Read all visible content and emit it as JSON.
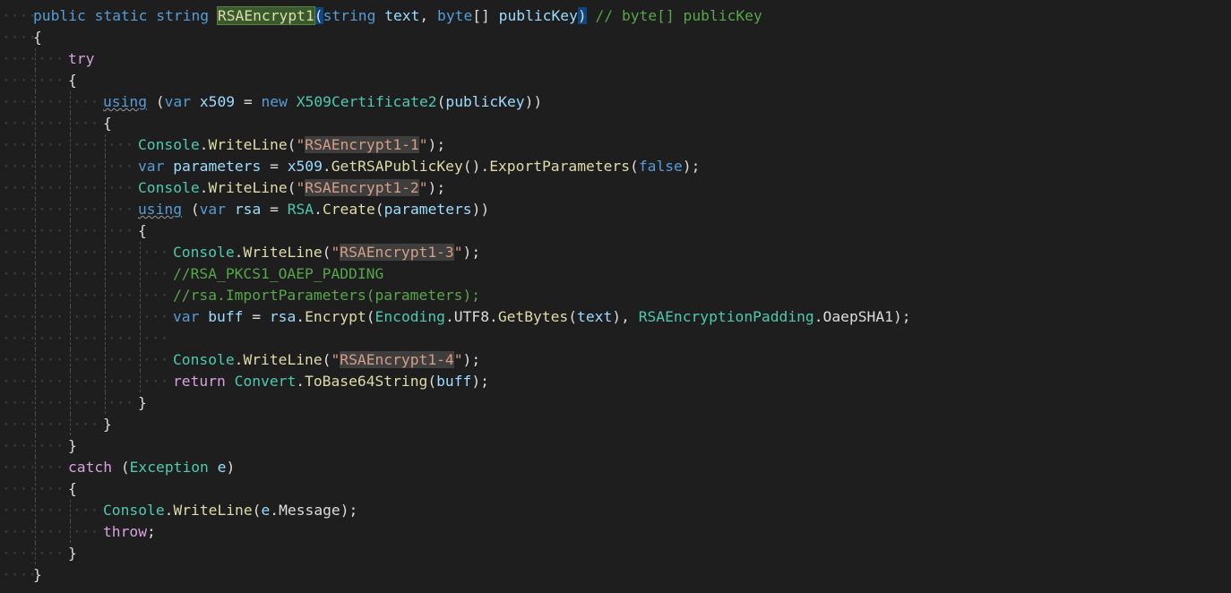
{
  "editor": {
    "colors": {
      "background": "#1e1e1e",
      "keyword": "#569cd6",
      "control_keyword": "#d8a0df",
      "type": "#4ec9b0",
      "method": "#dcdcaa",
      "string": "#d69d85",
      "comment": "#57a64a",
      "parameter": "#9cdcfe"
    },
    "lines": [
      {
        "indent": 0,
        "tokens": [
          {
            "t": "public",
            "c": "kw"
          },
          {
            "t": " "
          },
          {
            "t": "static",
            "c": "kw"
          },
          {
            "t": " "
          },
          {
            "t": "string",
            "c": "kw"
          },
          {
            "t": " "
          },
          {
            "t": "RSAEncrypt1",
            "c": "hl-method"
          },
          {
            "t": "(",
            "c": "hl-brace"
          },
          {
            "t": "string",
            "c": "kw"
          },
          {
            "t": " "
          },
          {
            "t": "text",
            "c": "par"
          },
          {
            "t": ", "
          },
          {
            "t": "byte",
            "c": "kw"
          },
          {
            "t": "[] "
          },
          {
            "t": "publicKey",
            "c": "par"
          },
          {
            "t": ")",
            "c": "hl-brace"
          },
          {
            "t": " "
          },
          {
            "t": "// byte[] publicKey",
            "c": "cmt"
          }
        ]
      },
      {
        "indent": 0,
        "tokens": [
          {
            "t": "{"
          }
        ]
      },
      {
        "indent": 1,
        "tokens": [
          {
            "t": "try",
            "c": "ctl"
          }
        ]
      },
      {
        "indent": 1,
        "tokens": [
          {
            "t": "{"
          }
        ]
      },
      {
        "indent": 2,
        "tokens": [
          {
            "t": "using",
            "c": "kw squiggle"
          },
          {
            "t": " ("
          },
          {
            "t": "var",
            "c": "kw"
          },
          {
            "t": " "
          },
          {
            "t": "x509",
            "c": "par"
          },
          {
            "t": " = "
          },
          {
            "t": "new",
            "c": "kw"
          },
          {
            "t": " "
          },
          {
            "t": "X509Certificate2",
            "c": "ty"
          },
          {
            "t": "("
          },
          {
            "t": "publicKey",
            "c": "par"
          },
          {
            "t": "))"
          }
        ]
      },
      {
        "indent": 2,
        "tokens": [
          {
            "t": "{"
          }
        ]
      },
      {
        "indent": 3,
        "tokens": [
          {
            "t": "Console",
            "c": "ty"
          },
          {
            "t": "."
          },
          {
            "t": "WriteLine",
            "c": "fn"
          },
          {
            "t": "("
          },
          {
            "t": "\"",
            "c": "str"
          },
          {
            "t": "RSAEncrypt1-1",
            "c": "str str-hl"
          },
          {
            "t": "\"",
            "c": "str"
          },
          {
            "t": ");"
          }
        ]
      },
      {
        "indent": 3,
        "tokens": [
          {
            "t": "var",
            "c": "kw"
          },
          {
            "t": " "
          },
          {
            "t": "parameters",
            "c": "par"
          },
          {
            "t": " = "
          },
          {
            "t": "x509",
            "c": "par"
          },
          {
            "t": "."
          },
          {
            "t": "GetRSAPublicKey",
            "c": "fn"
          },
          {
            "t": "()."
          },
          {
            "t": "ExportParameters",
            "c": "fn"
          },
          {
            "t": "("
          },
          {
            "t": "false",
            "c": "kw"
          },
          {
            "t": ");"
          }
        ]
      },
      {
        "indent": 3,
        "tokens": [
          {
            "t": "Console",
            "c": "ty"
          },
          {
            "t": "."
          },
          {
            "t": "WriteLine",
            "c": "fn"
          },
          {
            "t": "("
          },
          {
            "t": "\"",
            "c": "str"
          },
          {
            "t": "RSAEncrypt1-2",
            "c": "str str-hl"
          },
          {
            "t": "\"",
            "c": "str"
          },
          {
            "t": ");"
          }
        ]
      },
      {
        "indent": 3,
        "tokens": [
          {
            "t": "using",
            "c": "kw squiggle"
          },
          {
            "t": " ("
          },
          {
            "t": "var",
            "c": "kw"
          },
          {
            "t": " "
          },
          {
            "t": "rsa",
            "c": "par"
          },
          {
            "t": " = "
          },
          {
            "t": "RSA",
            "c": "ty"
          },
          {
            "t": "."
          },
          {
            "t": "Create",
            "c": "fn"
          },
          {
            "t": "("
          },
          {
            "t": "parameters",
            "c": "par"
          },
          {
            "t": "))"
          }
        ]
      },
      {
        "indent": 3,
        "tokens": [
          {
            "t": "{"
          }
        ]
      },
      {
        "indent": 4,
        "tokens": [
          {
            "t": "Console",
            "c": "ty"
          },
          {
            "t": "."
          },
          {
            "t": "WriteLine",
            "c": "fn"
          },
          {
            "t": "("
          },
          {
            "t": "\"",
            "c": "str"
          },
          {
            "t": "RSAEncrypt1-3",
            "c": "str str-hl"
          },
          {
            "t": "\"",
            "c": "str"
          },
          {
            "t": ");"
          }
        ]
      },
      {
        "indent": 4,
        "tokens": [
          {
            "t": "//RSA_PKCS1_OAEP_PADDING",
            "c": "cmt"
          }
        ]
      },
      {
        "indent": 4,
        "tokens": [
          {
            "t": "//rsa.ImportParameters(parameters);",
            "c": "cmt"
          }
        ]
      },
      {
        "indent": 4,
        "tokens": [
          {
            "t": "var",
            "c": "kw"
          },
          {
            "t": " "
          },
          {
            "t": "buff",
            "c": "par"
          },
          {
            "t": " = "
          },
          {
            "t": "rsa",
            "c": "par"
          },
          {
            "t": "."
          },
          {
            "t": "Encrypt",
            "c": "fn"
          },
          {
            "t": "("
          },
          {
            "t": "Encoding",
            "c": "ty"
          },
          {
            "t": "."
          },
          {
            "t": "UTF8"
          },
          {
            "t": "."
          },
          {
            "t": "GetBytes",
            "c": "fn"
          },
          {
            "t": "("
          },
          {
            "t": "text",
            "c": "par"
          },
          {
            "t": "), "
          },
          {
            "t": "RSAEncryptionPadding",
            "c": "ty"
          },
          {
            "t": "."
          },
          {
            "t": "OaepSHA1"
          },
          {
            "t": ");"
          }
        ]
      },
      {
        "indent": 4,
        "tokens": []
      },
      {
        "indent": 4,
        "tokens": [
          {
            "t": "Console",
            "c": "ty"
          },
          {
            "t": "."
          },
          {
            "t": "WriteLine",
            "c": "fn"
          },
          {
            "t": "("
          },
          {
            "t": "\"",
            "c": "str"
          },
          {
            "t": "RSAEncrypt1-4",
            "c": "str str-hl"
          },
          {
            "t": "\"",
            "c": "str"
          },
          {
            "t": ");"
          }
        ]
      },
      {
        "indent": 4,
        "tokens": [
          {
            "t": "return",
            "c": "ctl"
          },
          {
            "t": " "
          },
          {
            "t": "Convert",
            "c": "ty"
          },
          {
            "t": "."
          },
          {
            "t": "ToBase64String",
            "c": "fn"
          },
          {
            "t": "("
          },
          {
            "t": "buff",
            "c": "par"
          },
          {
            "t": ");"
          }
        ]
      },
      {
        "indent": 3,
        "tokens": [
          {
            "t": "}"
          }
        ]
      },
      {
        "indent": 2,
        "tokens": [
          {
            "t": "}"
          }
        ]
      },
      {
        "indent": 1,
        "tokens": [
          {
            "t": "}"
          }
        ]
      },
      {
        "indent": 1,
        "tokens": [
          {
            "t": "catch",
            "c": "ctl"
          },
          {
            "t": " ("
          },
          {
            "t": "Exception",
            "c": "ty"
          },
          {
            "t": " "
          },
          {
            "t": "e",
            "c": "par"
          },
          {
            "t": ")"
          }
        ]
      },
      {
        "indent": 1,
        "tokens": [
          {
            "t": "{"
          }
        ]
      },
      {
        "indent": 2,
        "tokens": [
          {
            "t": "Console",
            "c": "ty"
          },
          {
            "t": "."
          },
          {
            "t": "WriteLine",
            "c": "fn"
          },
          {
            "t": "("
          },
          {
            "t": "e",
            "c": "par"
          },
          {
            "t": "."
          },
          {
            "t": "Message"
          },
          {
            "t": ");"
          }
        ]
      },
      {
        "indent": 2,
        "tokens": [
          {
            "t": "throw",
            "c": "ctl"
          },
          {
            "t": ";"
          }
        ]
      },
      {
        "indent": 1,
        "tokens": [
          {
            "t": "}"
          }
        ]
      },
      {
        "indent": 0,
        "tokens": [
          {
            "t": "}"
          }
        ]
      }
    ]
  }
}
